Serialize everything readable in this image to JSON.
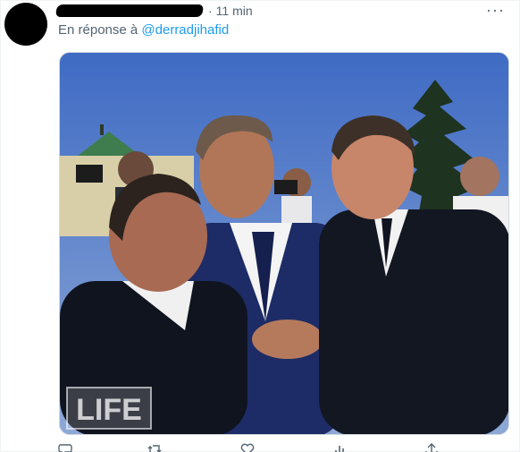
{
  "tweet": {
    "time": "11 min",
    "more_label": "···",
    "reply_prefix": "En réponse à",
    "reply_handle": "@derradjihafid",
    "media": {
      "watermark": "LIFE"
    }
  },
  "actions": [
    {
      "name": "reply",
      "icon": "reply-icon"
    },
    {
      "name": "retweet",
      "icon": "retweet-icon"
    },
    {
      "name": "like",
      "icon": "heart-icon"
    },
    {
      "name": "views",
      "icon": "views-icon"
    },
    {
      "name": "share",
      "icon": "share-icon"
    }
  ],
  "colors": {
    "link": "#1d9bf0",
    "muted": "#536471",
    "border": "#cfd9de"
  }
}
